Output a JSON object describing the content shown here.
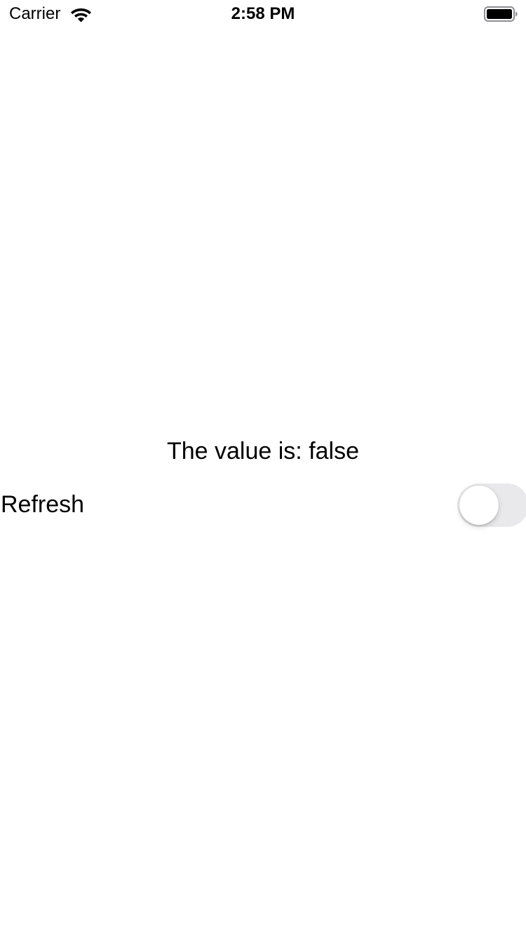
{
  "status_bar": {
    "carrier": "Carrier",
    "time": "2:58 PM",
    "wifi_icon": "wifi-icon",
    "battery_icon": "battery-full-icon"
  },
  "content": {
    "value_text": "The value is: false",
    "refresh_label": "Refresh",
    "toggle_on": false
  },
  "colors": {
    "background": "#ffffff",
    "text": "#000000",
    "toggle_off_track": "#e9e9eb"
  }
}
